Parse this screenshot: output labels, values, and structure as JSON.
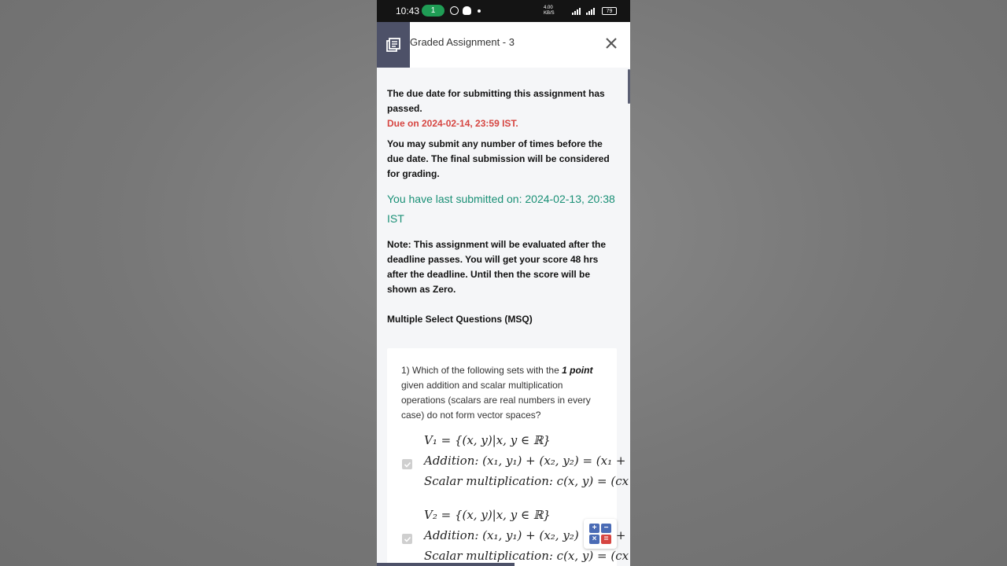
{
  "status_bar": {
    "time": "10:43",
    "notif_count": "1",
    "network_speed_top": "4.00",
    "network_speed_bottom": "KB/S",
    "battery": "79"
  },
  "header": {
    "title": "Graded Assignment - 3",
    "menu_icon": "library-books-icon",
    "close_icon": "close-icon"
  },
  "notice": {
    "passed": "The due date for submitting this assignment has passed.",
    "due": "Due on 2024-02-14, 23:59 IST.",
    "instructions": "You may submit any number of times before the due date. The final submission will be considered for grading.",
    "last_submitted": "You have last submitted on: 2024-02-13, 20:38 IST",
    "note": "Note: This assignment will be evaluated after the deadline passes. You will get your score 48 hrs after the deadline. Until then the score will be shown as Zero.",
    "section_title": "Multiple Select Questions (MSQ)"
  },
  "question": {
    "number": "1)",
    "text_before": "Which of the following sets with the",
    "points": "1 point",
    "text_after": "given addition and scalar multiplication operations (scalars are real numbers in every case) do not form vector spaces?",
    "options": [
      {
        "set": "V₁ = {(x, y)|x, y ∈ ℝ}",
        "addition": "Addition: (x₁, y₁) + (x₂, y₂) = (x₁ +",
        "scalar": "Scalar multiplication: c(x, y) = (cx",
        "checked": true
      },
      {
        "set": "V₂ = {(x, y)|x, y ∈ ℝ}",
        "addition": "Addition: (x₁, y₁) + (x₂, y₂) = (x₁ +",
        "scalar": "Scalar multiplication: c(x, y) = (cx",
        "checked": true
      }
    ]
  },
  "colors": {
    "accent": "#4d5168",
    "due_red": "#d64541",
    "submitted_green": "#1a9076"
  }
}
